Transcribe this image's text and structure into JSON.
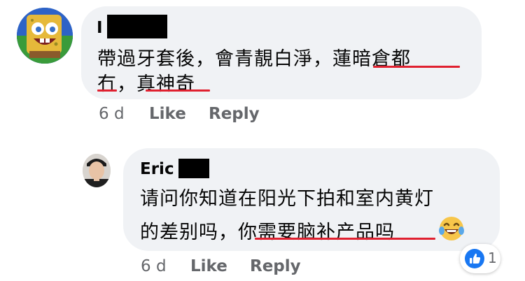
{
  "colors": {
    "bubble": "#f0f2f5",
    "underline": "#e0202f",
    "meta": "#65676b",
    "like_blue": "#1877f2"
  },
  "comments": [
    {
      "author": "I",
      "text_lines": [
        "帶過牙套後，會青靚白淨，蓮暗倉都",
        "冇，真神奇"
      ],
      "time": "6 d",
      "like_label": "Like",
      "reply_label": "Reply"
    },
    {
      "author": "Eric",
      "text_lines": [
        "请问你知道在阳光下拍和室内黄灯",
        "的差别吗，你需要脑补产品吗"
      ],
      "time": "6 d",
      "like_label": "Like",
      "reply_label": "Reply",
      "emoji": "laughing-with-tears-emoji",
      "reaction": {
        "icon": "thumbs-up-icon",
        "count": "1"
      }
    }
  ]
}
